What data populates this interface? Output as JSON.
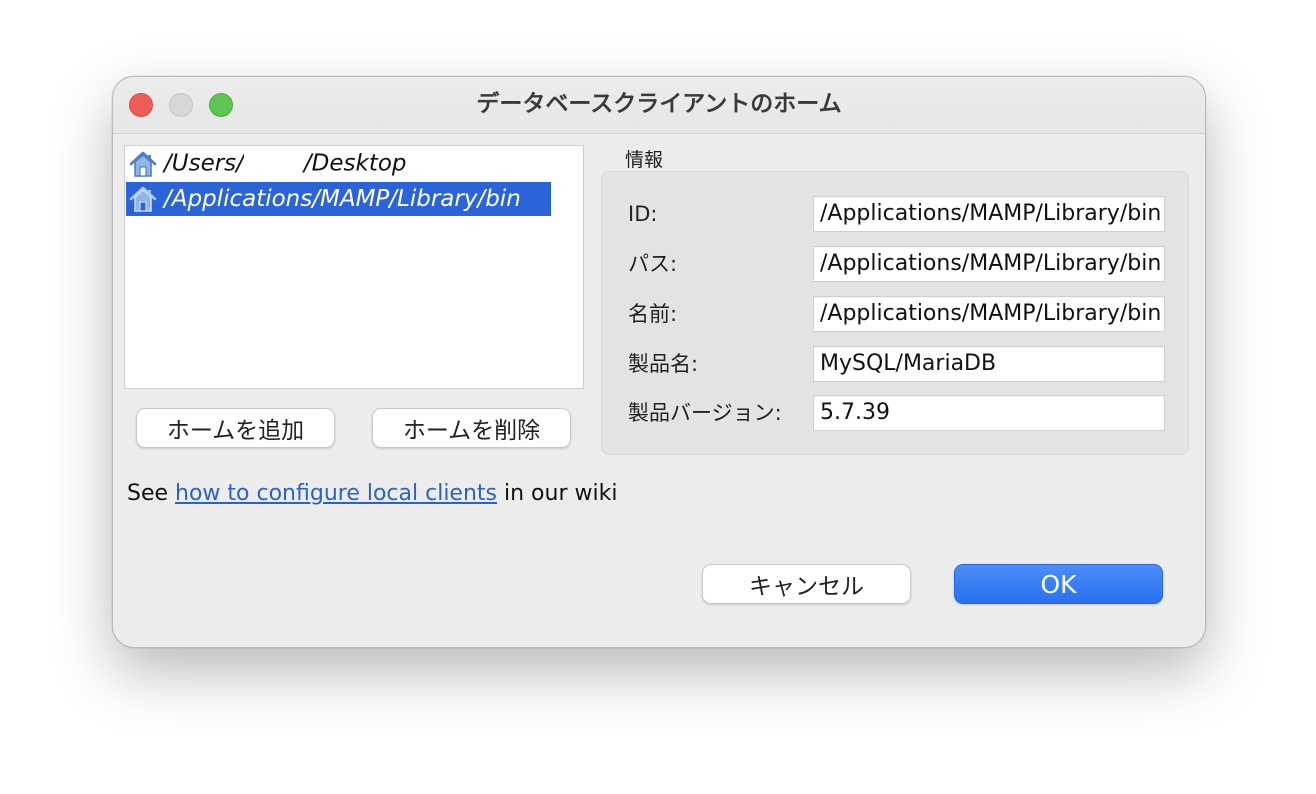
{
  "window": {
    "title": "データベースクライアントのホーム"
  },
  "homes": {
    "items": [
      {
        "label_prefix": "/Users/",
        "label_suffix": "/Desktop",
        "selected": false
      },
      {
        "label": "/Applications/MAMP/Library/bin",
        "selected": true
      }
    ]
  },
  "buttons": {
    "add_home": "ホームを追加",
    "remove_home": "ホームを削除",
    "cancel": "キャンセル",
    "ok": "OK"
  },
  "info": {
    "group_title": "情報",
    "fields": [
      {
        "label": "ID:",
        "value": "/Applications/MAMP/Library/bin"
      },
      {
        "label": "パス:",
        "value": "/Applications/MAMP/Library/bin"
      },
      {
        "label": "名前:",
        "value": "/Applications/MAMP/Library/bin"
      },
      {
        "label": "製品名:",
        "value": "MySQL/MariaDB"
      },
      {
        "label": "製品バージョン:",
        "value": "5.7.39"
      }
    ]
  },
  "wiki": {
    "prefix": "See ",
    "link_text": "how to configure local clients",
    "suffix": " in our wiki"
  },
  "colors": {
    "selection": "#2b63d9",
    "ok_button": "#3a7ef4",
    "link": "#2a63c7",
    "close": "#ee5d55",
    "minimize": "#d7d7d7",
    "maximize": "#5fc451"
  },
  "icons": {
    "home_item": "home-icon"
  }
}
